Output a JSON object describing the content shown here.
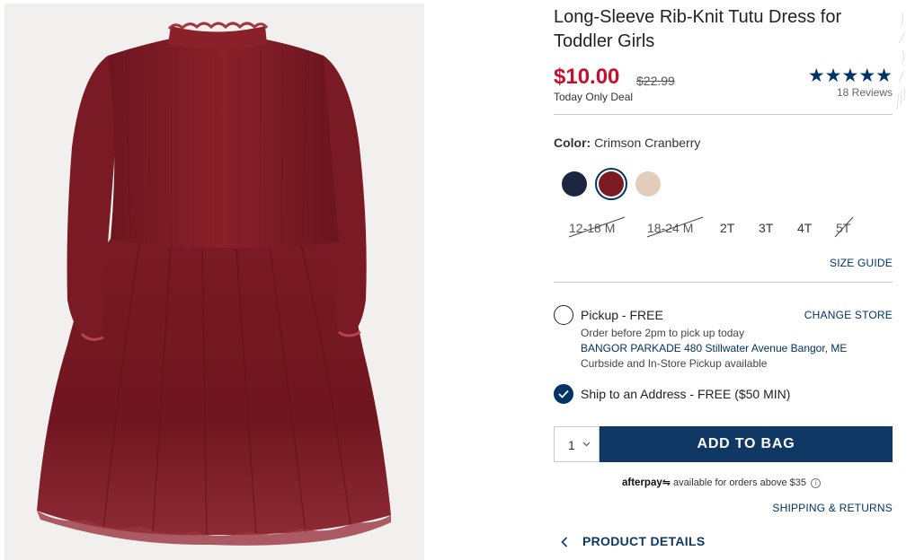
{
  "product": {
    "title": "Long-Sleeve Rib-Knit Tutu Dress for Toddler Girls",
    "price": "$10.00",
    "original_price": "$22.99",
    "deal_label": "Today Only Deal",
    "rating_stars": "★★★★★",
    "rating_value": 5,
    "reviews": "18 Reviews"
  },
  "color": {
    "label": "Color:",
    "selected_name": "Crimson Cranberry",
    "swatches": [
      {
        "name": "navy",
        "hex": "#1c2641"
      },
      {
        "name": "crimson cranberry",
        "hex": "#7a1a22",
        "selected": true
      },
      {
        "name": "pale pink",
        "hex": "#e2cdbd"
      }
    ]
  },
  "sizes": [
    {
      "label": "12-18 M",
      "available": false
    },
    {
      "label": "18-24 M",
      "available": false
    },
    {
      "label": "2T",
      "available": true
    },
    {
      "label": "3T",
      "available": true
    },
    {
      "label": "4T",
      "available": true
    },
    {
      "label": "5T",
      "available": false
    }
  ],
  "size_guide": "SIZE GUIDE",
  "fulfillment": {
    "pickup_label": "Pickup - FREE",
    "change_store": "CHANGE STORE",
    "pickup_note": "Order before 2pm to pick up today",
    "store_address": "BANGOR PARKADE 480 Stillwater Avenue  Bangor, ME",
    "pickup_options": "Curbside and In-Store Pickup available",
    "ship_label": "Ship to an Address - FREE ($50 MIN)"
  },
  "cart": {
    "quantity": "1",
    "add_to_bag": "ADD TO BAG"
  },
  "afterpay": {
    "brand": "afterpay",
    "text": "available for orders above $35",
    "info": "i"
  },
  "links": {
    "shipping_returns": "SHIPPING & RETURNS",
    "product_details": "PRODUCT DETAILS"
  },
  "colors": {
    "accent": "#003366",
    "price_red": "#c8102e",
    "button": "#0f3865"
  },
  "icons": {
    "chevron_down": "chevron-down-icon",
    "chevron_left": "chevron-left-icon",
    "check": "check-icon",
    "info": "info-icon"
  }
}
